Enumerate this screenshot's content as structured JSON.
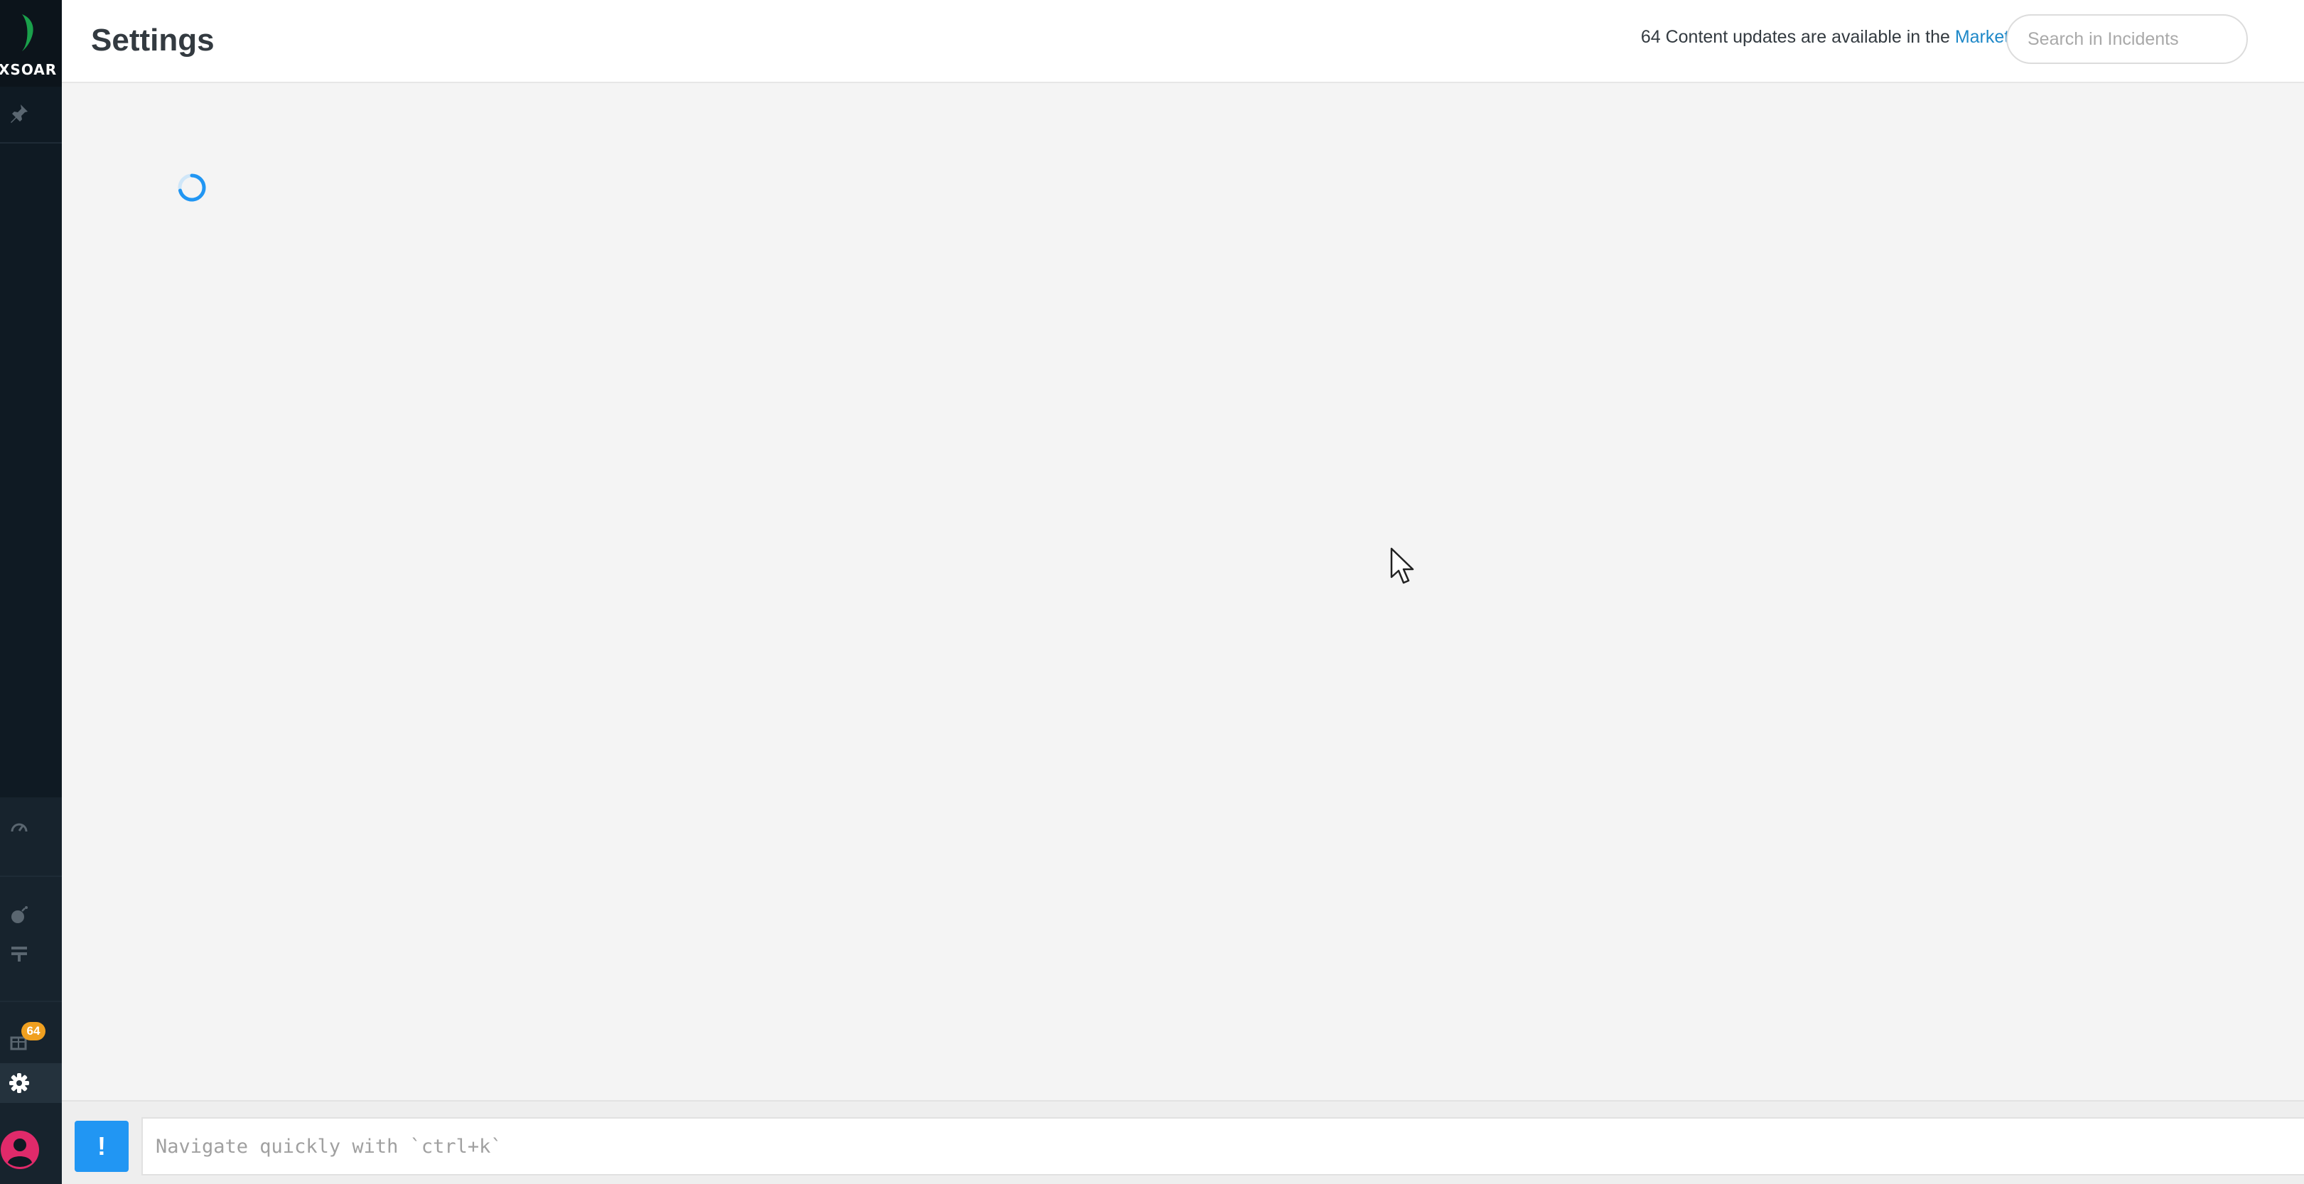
{
  "app": {
    "brand": "XSOAR",
    "page_title": "Settings"
  },
  "header": {
    "updates_prefix": "64 Content updates are available in the ",
    "updates_link": "Marketplace",
    "search_placeholder": "Search in Incidents"
  },
  "sidebar": {
    "items": [
      {
        "name": "pin",
        "icon": "pin-icon"
      },
      {
        "name": "dashboard",
        "icon": "gauge-icon"
      },
      {
        "name": "threat-intel",
        "icon": "bomb-icon"
      },
      {
        "name": "playbooks",
        "icon": "flow-icon"
      },
      {
        "name": "marketplace",
        "icon": "store-icon",
        "badge": "64"
      },
      {
        "name": "settings",
        "icon": "gear-icon",
        "active": true
      },
      {
        "name": "user",
        "icon": "avatar-icon"
      }
    ]
  },
  "content": {
    "state": "loading",
    "spinner_color": "#2196f3"
  },
  "bottom_bar": {
    "alert_label": "!",
    "nav_placeholder": "Navigate quickly with `ctrl+k`"
  },
  "colors": {
    "sidebar": "#0f1a23",
    "accent": "#2196f3",
    "link": "#1e88c8",
    "badge": "#f0a020",
    "logo_green": "#1db954",
    "avatar": "#e02a6a"
  }
}
